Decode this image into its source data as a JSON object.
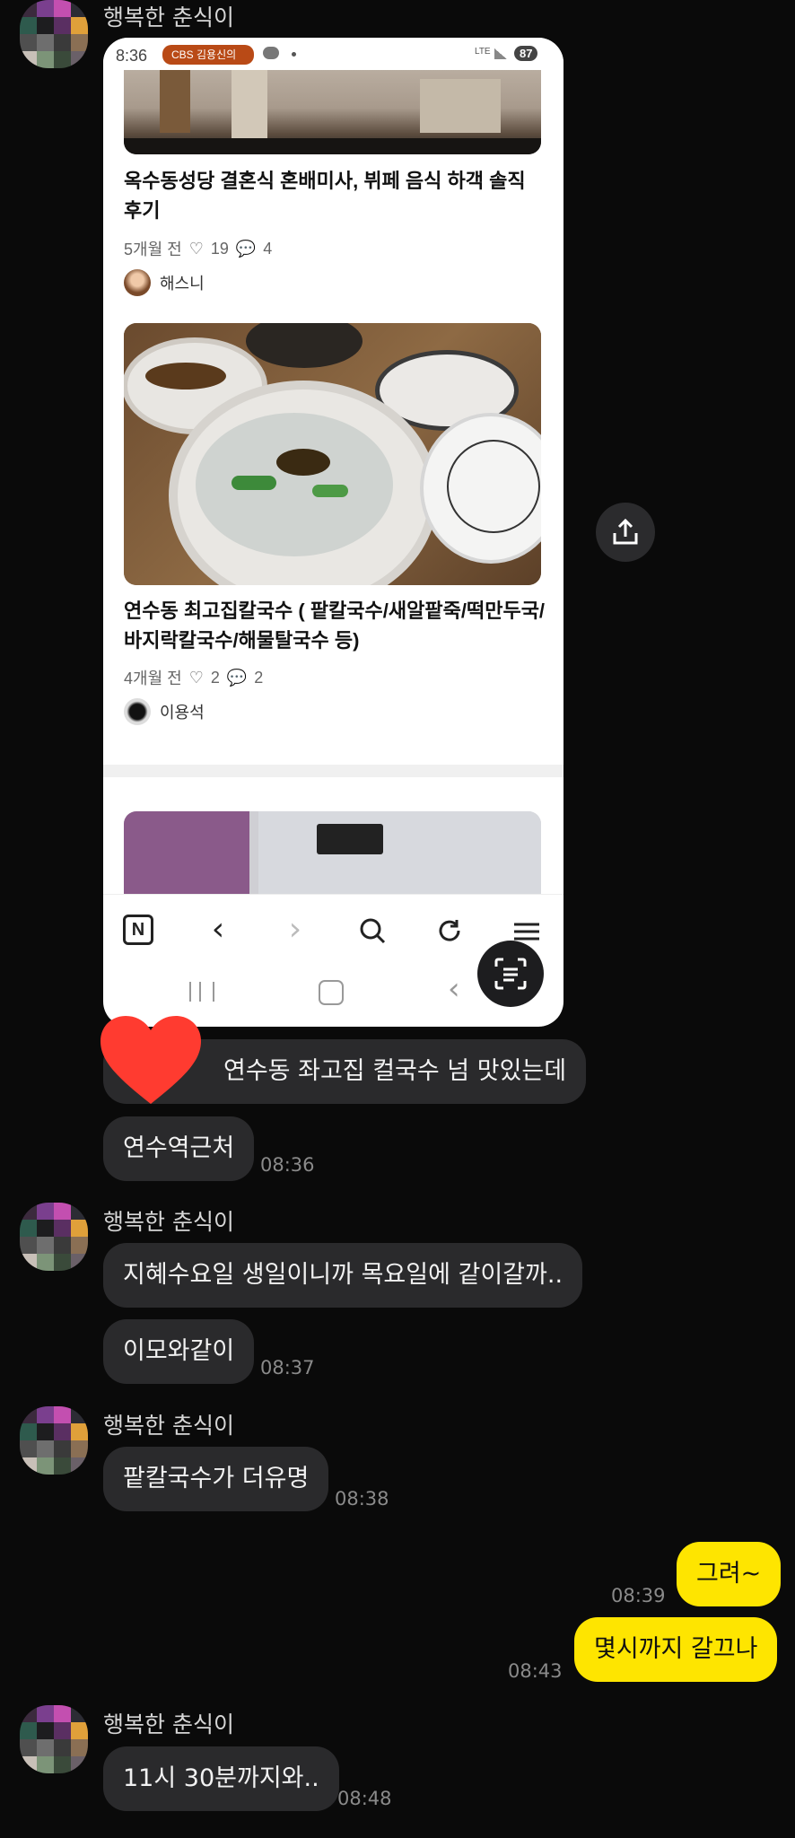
{
  "shared_screenshot": {
    "status_time": "8:36",
    "status_badge": "CBS 김용신의",
    "status_net": "LTE",
    "status_battery": "87",
    "post1": {
      "title": "옥수동성당 결혼식 혼배미사, 뷔페 음식 하객 솔직 후기",
      "age": "5개월 전",
      "likes": "19",
      "comments": "4",
      "author": "해스니"
    },
    "post2": {
      "title": "연수동 최고집칼국수 ( 팥칼국수/새알팥죽/떡만두국/바지락칼국수/해물탈국수 등)",
      "age": "4개월 전",
      "likes": "2",
      "comments": "2",
      "author": "이용석"
    }
  },
  "messages": [
    {
      "sender": "행복한 춘식이",
      "bubbles": [
        "연수동 좌고집  컬국수 넘 맛있는데",
        "연수역근처"
      ],
      "time": "08:36"
    },
    {
      "sender": "행복한 춘식이",
      "bubbles": [
        "지혜수요일 생일이니까 목요일에 같이갈까..",
        "이모와같이"
      ],
      "time": "08:37"
    },
    {
      "sender": "행복한 춘식이",
      "bubbles": [
        "팥칼국수가 더유명"
      ],
      "time": "08:38"
    },
    {
      "mine": true,
      "bubbles": [
        "그려~"
      ],
      "time": "08:39"
    },
    {
      "mine": true,
      "bubbles": [
        "몇시까지 갈끄나"
      ],
      "time": "08:43"
    },
    {
      "sender": "행복한 춘식이",
      "bubbles": [
        "11시 30분까지와.."
      ],
      "time": "08:48"
    }
  ],
  "colors": {
    "background": "#0a0a0a",
    "bubble_other": "#2a2a2c",
    "bubble_mine": "#fee500",
    "reaction_heart": "#ff3b30"
  },
  "icons": [
    "share-icon",
    "heart-reaction-icon",
    "naver-icon",
    "back-icon",
    "forward-icon",
    "search-icon",
    "refresh-icon",
    "menu-icon",
    "text-scan-icon",
    "recent-apps-icon",
    "home-icon",
    "nav-back-icon"
  ]
}
